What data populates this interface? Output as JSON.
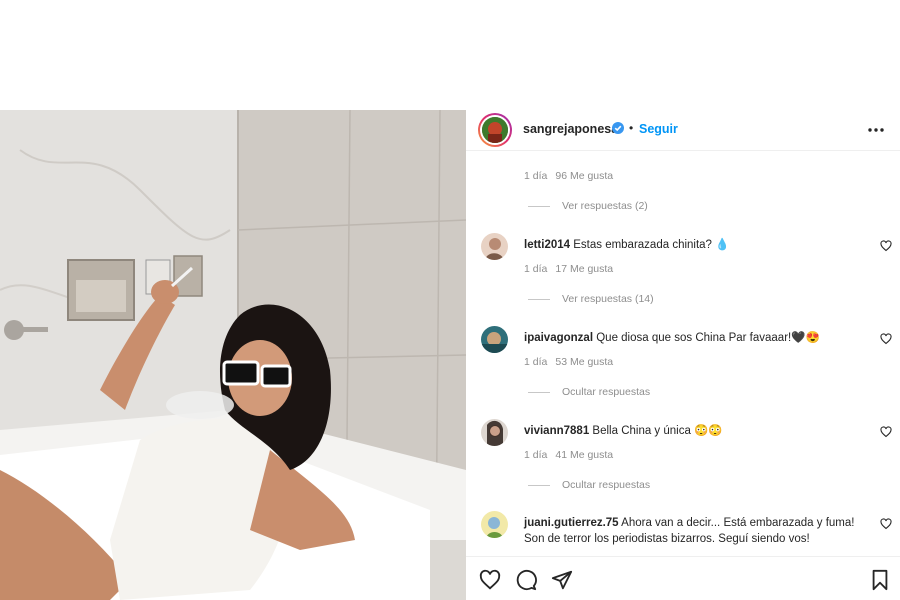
{
  "post": {
    "username": "sangrejaponesa",
    "follow_label": "Seguir",
    "separator": "•"
  },
  "icons": {
    "more": "more-options-icon",
    "verified": "verified-badge-icon",
    "like": "heart-icon",
    "comment": "comment-icon",
    "share": "share-icon",
    "save": "bookmark-icon"
  },
  "colors": {
    "accent": "#0095f6",
    "verified": "#3897f0",
    "muted": "#8e8e8e"
  },
  "first_meta": {
    "time": "1 día",
    "likes": "96 Me gusta"
  },
  "first_replies": "Ver respuestas (2)",
  "comments": [
    {
      "user": "letti2014",
      "text": "Estas embarazada chinita? 💧",
      "time": "1 día",
      "likes": "17 Me gusta",
      "replies": "Ver respuestas (14)"
    },
    {
      "user": "ipaivagonzal",
      "text": "Que diosa que sos China Par favaaar!🖤😍",
      "time": "1 día",
      "likes": "53 Me gusta",
      "replies": "Ocultar respuestas"
    },
    {
      "user": "viviann7881",
      "text": "Bella China y única 😳😳",
      "time": "1 día",
      "likes": "41 Me gusta",
      "replies": "Ocultar respuestas"
    },
    {
      "user": "juani.gutierrez.75",
      "text": "Ahora van a decir... Está embarazada y fuma! Son de terror los periodistas bizarros. Seguí siendo vos!"
    }
  ]
}
